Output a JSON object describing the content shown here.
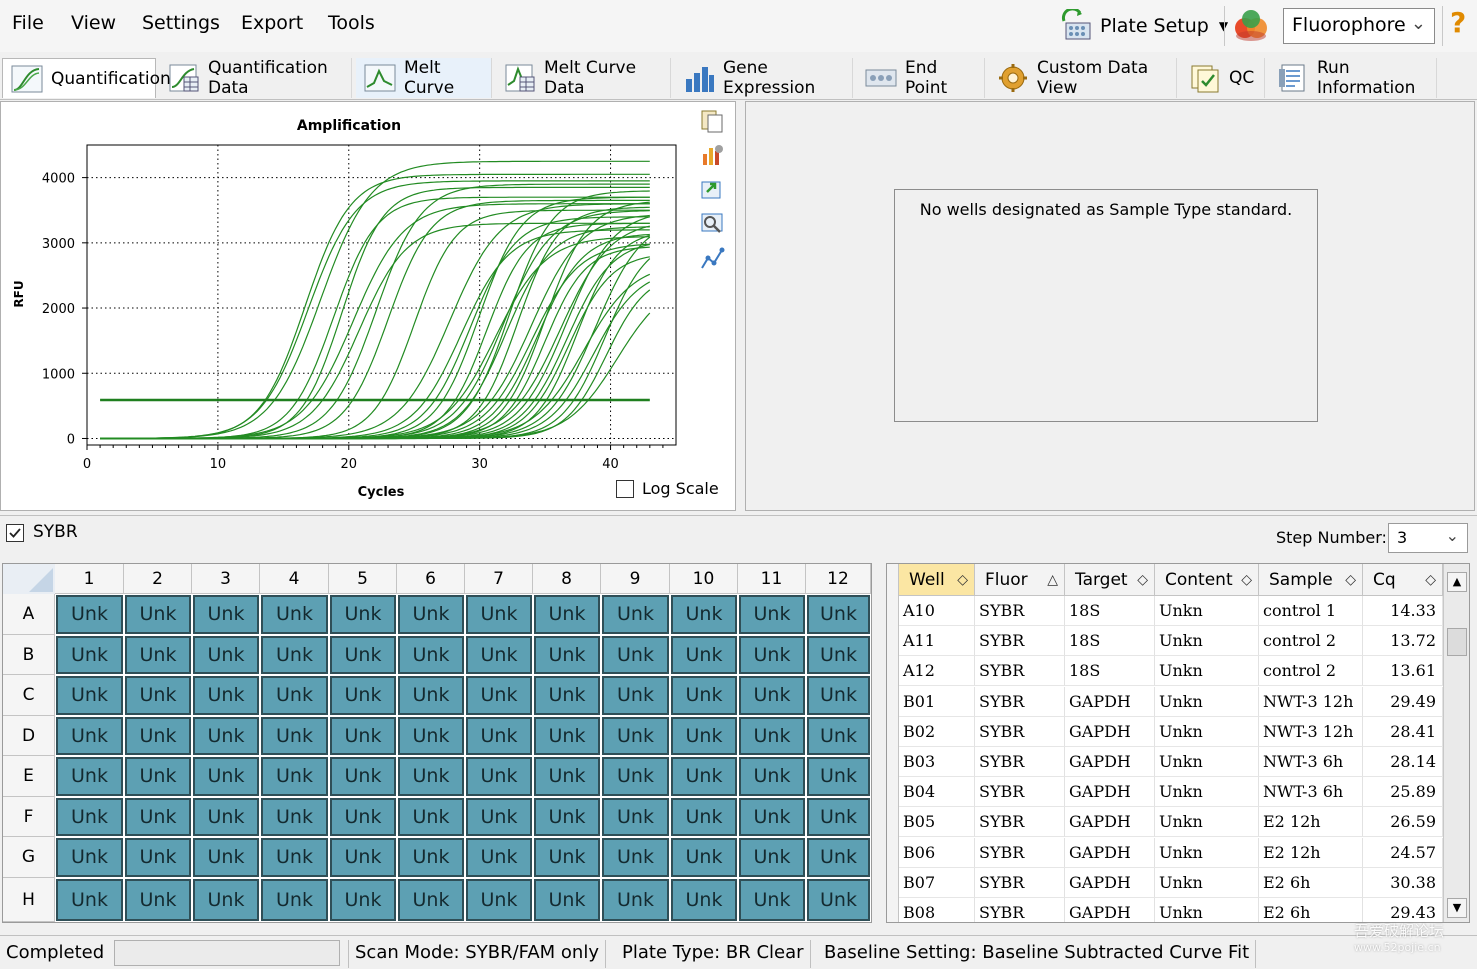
{
  "menu": {
    "file": "File",
    "view": "View",
    "settings": "Settings",
    "export": "Export",
    "tools": "Tools"
  },
  "toolbar": {
    "plate_setup": "Plate Setup",
    "fluorophore": "Fluorophore",
    "help": "?"
  },
  "tabs": [
    {
      "label": "Quantification",
      "icon": "amplification-chart-icon"
    },
    {
      "label": "Quantification Data",
      "icon": "data-table-icon"
    },
    {
      "label": "Melt Curve",
      "icon": "melt-curve-icon"
    },
    {
      "label": "Melt Curve Data",
      "icon": "melt-data-icon"
    },
    {
      "label": "Gene Expression",
      "icon": "bar-chart-icon"
    },
    {
      "label": "End Point",
      "icon": "end-point-icon"
    },
    {
      "label": "Custom Data View",
      "icon": "gear-icon"
    },
    {
      "label": "QC",
      "icon": "qc-icon"
    },
    {
      "label": "Run Information",
      "icon": "document-icon"
    }
  ],
  "chart": {
    "log_scale_label": "Log Scale",
    "log_scale_checked": false
  },
  "chart_data": {
    "type": "line",
    "title": "Amplification",
    "xlabel": "Cycles",
    "ylabel": "RFU",
    "xlim": [
      0,
      45
    ],
    "ylim": [
      -100,
      4500
    ],
    "xticks": [
      0,
      10,
      20,
      30,
      40
    ],
    "yticks": [
      0,
      1000,
      2000,
      3000,
      4000
    ],
    "grid": true,
    "color": "#228b22",
    "threshold": 590,
    "cycles_range": [
      1,
      43
    ],
    "series_cq": [
      14.33,
      13.72,
      13.61,
      16.1,
      16.8,
      17.2,
      18.0,
      19.1,
      20.3,
      22.5,
      24.57,
      25.89,
      26.59,
      27.2,
      28.14,
      28.41,
      28.9,
      29.43,
      29.49,
      30.38,
      30.9,
      31.4,
      31.9,
      32.3,
      32.8,
      33.2,
      33.7,
      34.2,
      34.6,
      35.1,
      35.5,
      36.0,
      36.6,
      37.2,
      37.8,
      38.3
    ],
    "series_plateau": [
      4250,
      3950,
      4050,
      3700,
      3850,
      3600,
      3300,
      3900,
      3650,
      3500,
      3600,
      3200,
      3400,
      3700,
      3300,
      3100,
      3500,
      3250,
      3800,
      3550,
      3450,
      3000,
      3150,
      3650,
      2950,
      3350,
      3500,
      3050,
      2850,
      3200,
      2700,
      3400,
      2600,
      3100,
      2550,
      2450
    ]
  },
  "standard_panel": {
    "message": "No wells designated as Sample Type standard."
  },
  "fluor_row": {
    "label": "SYBR",
    "checked": true,
    "step_label": "Step Number:",
    "step_value": "3"
  },
  "plate": {
    "columns": [
      "1",
      "2",
      "3",
      "4",
      "5",
      "6",
      "7",
      "8",
      "9",
      "10",
      "11",
      "12"
    ],
    "rows": [
      "A",
      "B",
      "C",
      "D",
      "E",
      "F",
      "G",
      "H"
    ],
    "well_label": "Unk"
  },
  "table": {
    "headers": [
      "Well",
      "Fluor",
      "Target",
      "Content",
      "Sample",
      "Cq"
    ],
    "rows": [
      [
        "A10",
        "SYBR",
        "18S",
        "Unkn",
        "control 1",
        "14.33"
      ],
      [
        "A11",
        "SYBR",
        "18S",
        "Unkn",
        "control 2",
        "13.72"
      ],
      [
        "A12",
        "SYBR",
        "18S",
        "Unkn",
        "control 2",
        "13.61"
      ],
      [
        "B01",
        "SYBR",
        "GAPDH",
        "Unkn",
        "NWT-3 12h",
        "29.49"
      ],
      [
        "B02",
        "SYBR",
        "GAPDH",
        "Unkn",
        "NWT-3 12h",
        "28.41"
      ],
      [
        "B03",
        "SYBR",
        "GAPDH",
        "Unkn",
        "NWT-3 6h",
        "28.14"
      ],
      [
        "B04",
        "SYBR",
        "GAPDH",
        "Unkn",
        "NWT-3 6h",
        "25.89"
      ],
      [
        "B05",
        "SYBR",
        "GAPDH",
        "Unkn",
        "E2 12h",
        "26.59"
      ],
      [
        "B06",
        "SYBR",
        "GAPDH",
        "Unkn",
        "E2 12h",
        "24.57"
      ],
      [
        "B07",
        "SYBR",
        "GAPDH",
        "Unkn",
        "E2 6h",
        "30.38"
      ],
      [
        "B08",
        "SYBR",
        "GAPDH",
        "Unkn",
        "E2 6h",
        "29.43"
      ]
    ]
  },
  "status": {
    "state": "Completed",
    "scan_mode": "Scan Mode: SYBR/FAM only",
    "plate_type": "Plate Type: BR Clear",
    "baseline": "Baseline Setting: Baseline Subtracted Curve Fit"
  },
  "watermark": {
    "line1": "吾爱破解论坛",
    "line2": "www.52pojie.cn"
  }
}
